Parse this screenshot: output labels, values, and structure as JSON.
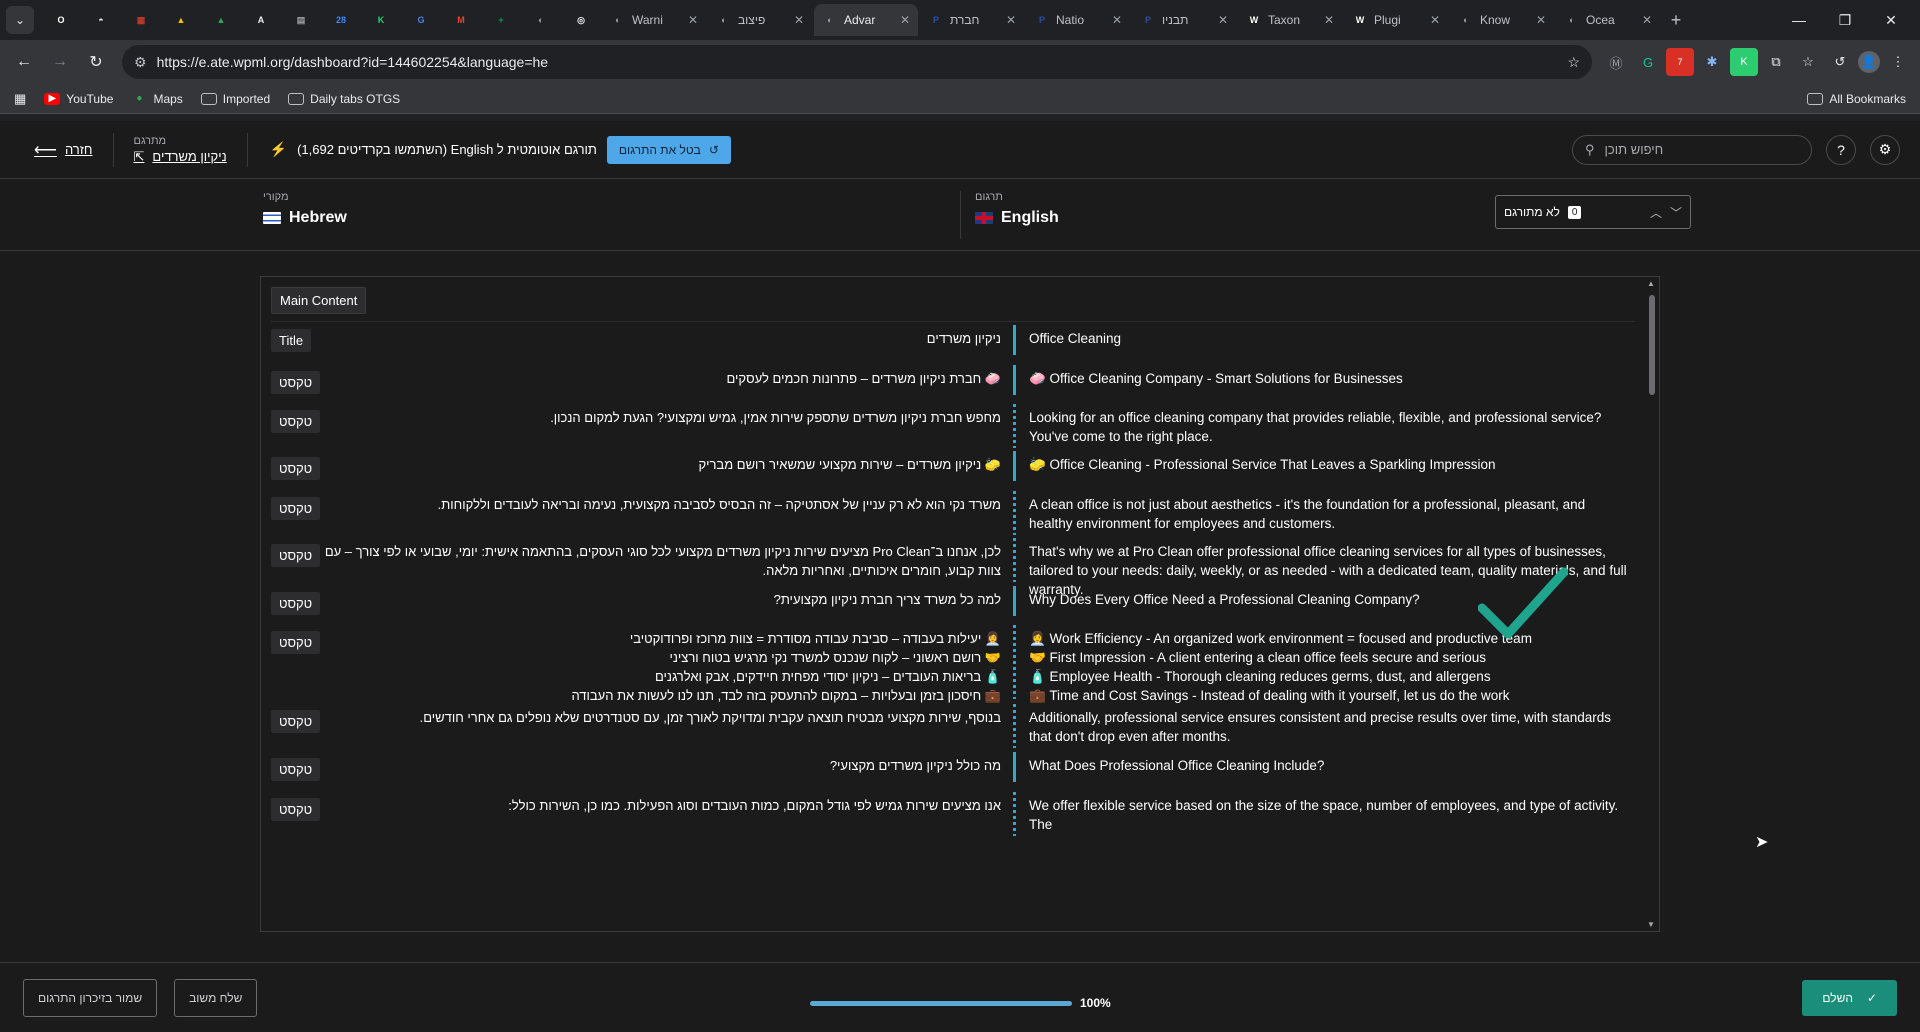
{
  "browser": {
    "tabs": [
      {
        "title": "",
        "fav": "O",
        "color": "#ffffff",
        "pinned": true
      },
      {
        "title": "",
        "fav": "◓",
        "color": "#e8eaed",
        "pinned": true
      },
      {
        "title": "",
        "fav": "▦",
        "color": "#c0392b",
        "pinned": true
      },
      {
        "title": "",
        "fav": "▲",
        "color": "#fbbc04",
        "pinned": true
      },
      {
        "title": "",
        "fav": "▲",
        "color": "#34a853",
        "pinned": true
      },
      {
        "title": "",
        "fav": "A",
        "color": "#eeeeee",
        "pinned": true
      },
      {
        "title": "",
        "fav": "▤",
        "color": "#9e9e9e",
        "pinned": true
      },
      {
        "title": "",
        "fav": "28",
        "color": "#4285f4",
        "pinned": true
      },
      {
        "title": "",
        "fav": "K",
        "color": "#2ecc71",
        "pinned": true
      },
      {
        "title": "",
        "fav": "G",
        "color": "#4285f4",
        "pinned": true
      },
      {
        "title": "",
        "fav": "M",
        "color": "#ea4335",
        "pinned": true
      },
      {
        "title": "",
        "fav": "+",
        "color": "#0f9d58",
        "pinned": true
      },
      {
        "title": "",
        "fav": "◐",
        "color": "#9aa0a6",
        "pinned": true
      },
      {
        "title": "",
        "fav": "◎",
        "color": "#e8eaed",
        "pinned": true
      },
      {
        "title": "Warni",
        "fav": "◐",
        "color": "#9aa0a6"
      },
      {
        "title": "פיצוב",
        "fav": "◐",
        "color": "#9aa0a6"
      },
      {
        "title": "Advar",
        "fav": "◐",
        "color": "#9aa0a6",
        "active": true
      },
      {
        "title": "חברת",
        "fav": "P",
        "color": "#2b4e9e"
      },
      {
        "title": "Natio",
        "fav": "P",
        "color": "#2b4e9e"
      },
      {
        "title": "תבניו",
        "fav": "P",
        "color": "#2b4e9e"
      },
      {
        "title": "Taxon",
        "fav": "W",
        "color": "#ffffff"
      },
      {
        "title": "Plugi",
        "fav": "W",
        "color": "#ffffff"
      },
      {
        "title": "Know",
        "fav": "◐",
        "color": "#9aa0a6"
      },
      {
        "title": "Ocea",
        "fav": "◐",
        "color": "#9aa0a6"
      }
    ],
    "url": "https://e.ate.wpml.org/dashboard?id=144602254&language=he",
    "bookmarks": [
      {
        "label": "YouTube",
        "icon": "youtube-icon"
      },
      {
        "label": "Maps",
        "icon": "maps-icon"
      },
      {
        "label": "Imported",
        "icon": "folder-icon"
      },
      {
        "label": "Daily tabs OTGS",
        "icon": "folder-icon"
      }
    ],
    "all_bookmarks": "All Bookmarks"
  },
  "header": {
    "back_label": "חזרה",
    "job_label": "מתרגם",
    "job_name": "ניקיון משרדים",
    "auto_text": "תורגם אוטומטית ל English (השתמשו בקרדיטים 1,692)",
    "cancel_label": "בטל את התרגום",
    "search_placeholder": "חיפוש תוכן"
  },
  "languages": {
    "source_label": "מקורי",
    "source_name": "Hebrew",
    "target_label": "תרגום",
    "target_name": "English",
    "untranslated_label": "לא מתורגם",
    "untranslated_count": "0"
  },
  "editor": {
    "section": "Main Content",
    "rows": [
      {
        "type": "Title",
        "src": "ניקיון משרדים",
        "tgt": "Office Cleaning",
        "bar": "solid"
      },
      {
        "type": "טקסט",
        "src": "🧼 חברת ניקיון משרדים – פתרונות חכמים לעסקים",
        "tgt": "🧼 Office Cleaning Company - Smart Solutions for Businesses",
        "bar": "solid"
      },
      {
        "type": "טקסט",
        "src": "מחפש חברת ניקיון משרדים שתספק שירות אמין, גמיש ומקצועי? הגעת למקום הנכון.",
        "tgt": "Looking for an office cleaning company that provides reliable, flexible, and professional service? You've come to the right place.",
        "bar": "dotted"
      },
      {
        "type": "טקסט",
        "src": "🧽 ניקיון משרדים – שירות מקצועי שמשאיר רושם מבריק",
        "tgt": "🧽 Office Cleaning - Professional Service That Leaves a Sparkling Impression",
        "bar": "solid"
      },
      {
        "type": "טקסט",
        "src": "משרד נקי הוא לא רק עניין של אסתטיקה – זה הבסיס לסביבה מקצועית, נעימה ובריאה לעובדים וללקוחות.",
        "tgt": "A clean office is not just about aesthetics - it's the foundation for a professional, pleasant, and healthy environment for employees and customers.",
        "bar": "dotted"
      },
      {
        "type": "טקסט",
        "src": "לכן, אנחנו ב־Pro Clean מציעים שירות ניקיון משרדים מקצועי לכל סוגי העסקים, בהתאמה אישית: יומי, שבועי או לפי צורך – עם צוות קבוע, חומרים איכותיים, ואחריות מלאה.",
        "tgt": "That's why we at Pro Clean offer professional office cleaning services for all types of businesses, tailored to your needs: daily, weekly, or as needed - with a dedicated team, quality materials, and full warranty.",
        "bar": "dotted"
      },
      {
        "type": "טקסט",
        "src": "למה כל משרד צריך חברת ניקיון מקצועית?",
        "tgt": "Why Does Every Office Need a Professional Cleaning Company?",
        "bar": "solid"
      },
      {
        "type": "טקסט",
        "src": "👩‍💼 יעילות בעבודה – סביבת עבודה מסודרת = צוות מרוכז ופרודוקטיבי\n🤝 רושם ראשוני – לקוח שנכנס למשרד נקי מרגיש בטוח ורציני\n🧴 בריאות העובדים – ניקיון יסודי מפחית חיידקים, אבק ואלרגנים\n💼 חיסכון בזמן ובעלויות – במקום להתעסק בזה לבד, תנו לנו לעשות את העבודה",
        "tgt": "👩‍💼 Work Efficiency - An organized work environment = focused and productive team\n🤝 First Impression - A client entering a clean office feels secure and serious\n🧴 Employee Health - Thorough cleaning reduces germs, dust, and allergens\n💼 Time and Cost Savings - Instead of dealing with it yourself, let us do the work",
        "bar": "dotted"
      },
      {
        "type": "טקסט",
        "src": "בנוסף, שירות מקצועי מבטיח תוצאה עקבית ומדויקת לאורך זמן, עם סטנדרטים שלא נופלים גם אחרי חודשים.",
        "tgt": "Additionally, professional service ensures consistent and precise results over time, with standards that don't drop even after months.",
        "bar": "dotted"
      },
      {
        "type": "טקסט",
        "src": "מה כולל ניקיון משרדים מקצועי?",
        "tgt": "What Does Professional Office Cleaning Include?",
        "bar": "solid"
      },
      {
        "type": "טקסט",
        "src": "אנו מציעים שירות גמיש לפי גודל המקום, כמות העובדים וסוג הפעילות. כמו כן, השירות כולל:",
        "tgt": "We offer flexible service based on the size of the space, number of employees, and type of activity. The",
        "bar": "dotted"
      }
    ]
  },
  "footer": {
    "save_memory_label": "שמור בזיכרון התרגום",
    "feedback_label": "שלח משוב",
    "progress": 100,
    "progress_text": "100%",
    "finish_label": "השלם"
  },
  "colors": {
    "accent": "#4ea7e8",
    "finish": "#1b8e7b",
    "check": "#1fa58e"
  }
}
